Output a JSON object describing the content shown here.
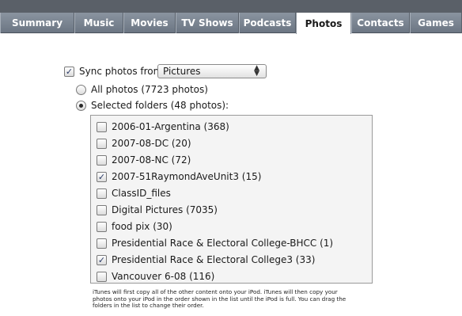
{
  "tabs": [
    {
      "label": "Summary"
    },
    {
      "label": "Music"
    },
    {
      "label": "Movies"
    },
    {
      "label": "TV Shows"
    },
    {
      "label": "Podcasts"
    },
    {
      "label": "Photos",
      "active": true
    },
    {
      "label": "Contacts"
    },
    {
      "label": "Games"
    }
  ],
  "sync": {
    "label": "Sync photos from:",
    "checked": true,
    "source_value": "Pictures"
  },
  "options": {
    "all_label": "All photos (7723 photos)",
    "selected_label": "Selected folders (48 photos):",
    "selected_option": "selected"
  },
  "folders": [
    {
      "label": "2006-01-Argentina (368)",
      "checked": false
    },
    {
      "label": "2007-08-DC (20)",
      "checked": false
    },
    {
      "label": "2007-08-NC (72)",
      "checked": false
    },
    {
      "label": "2007-51RaymondAveUnit3 (15)",
      "checked": true
    },
    {
      "label": "ClassID_files",
      "checked": false
    },
    {
      "label": "Digital Pictures (7035)",
      "checked": false
    },
    {
      "label": "food pix (30)",
      "checked": false
    },
    {
      "label": "Presidential Race & Electoral College-BHCC (1)",
      "checked": false
    },
    {
      "label": "Presidential Race & Electoral College3 (33)",
      "checked": true
    },
    {
      "label": "Vancouver 6-08 (116)",
      "checked": false
    }
  ],
  "note": "iTunes will first copy all of the other content onto your iPod. iTunes will then copy your photos onto your iPod in the order shown in the list until the iPod is full. You can drag the folders in the list to change their order."
}
